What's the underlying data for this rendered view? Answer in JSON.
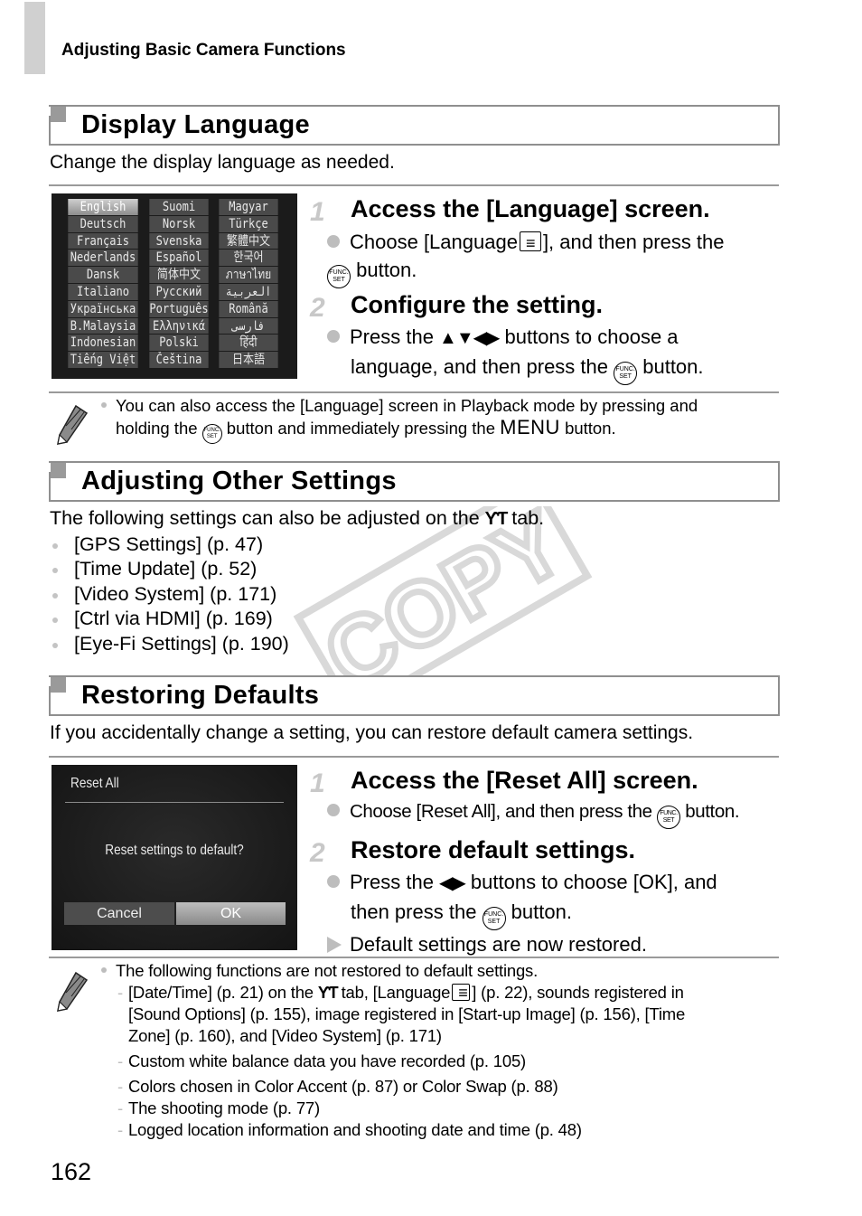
{
  "running_head": "Adjusting Basic Camera Functions",
  "page_number": "162",
  "watermark": "COPY",
  "sections": {
    "display_language": {
      "title": "Display Language",
      "intro": "Change the display language as needed.",
      "screen": {
        "languages": [
          "English",
          "Suomi",
          "Magyar",
          "Deutsch",
          "Norsk",
          "Türkçe",
          "Français",
          "Svenska",
          "繁體中文",
          "Nederlands",
          "Español",
          "한국어",
          "Dansk",
          "简体中文",
          "ภาษาไทย",
          "Italiano",
          "Русский",
          "العربية",
          "Українська",
          "Português",
          "Română",
          "B.Malaysia",
          "Ελληνικά",
          "فارسی",
          "Indonesian",
          "Polski",
          "हिंदी",
          "Tiếng Việt",
          "Čeština",
          "日本語"
        ],
        "selected": "English"
      },
      "steps": [
        {
          "number": "1",
          "title": "Access the [Language] screen.",
          "bullet_part1": "Choose [Language",
          "bullet_part2": "], and then press the",
          "bullet_line2": " button."
        },
        {
          "number": "2",
          "title": "Configure the setting.",
          "bullet_part1": "Press the ",
          "arrows": "▲▼◀▶",
          "bullet_part2": " buttons to choose a",
          "bullet_line2a": "language, and then press the ",
          "bullet_line2b": " button."
        }
      ],
      "note": {
        "line1": "You can also access the [Language] screen in Playback mode by pressing and",
        "line2a": "holding the ",
        "line2b": " button and immediately pressing the ",
        "menu": "MENU",
        "line2c": " button."
      }
    },
    "other_settings": {
      "title": "Adjusting Other Settings",
      "intro_a": "The following settings can also be adjusted on the ",
      "tab_icon": "ƳƬ",
      "intro_b": " tab.",
      "items": [
        "[GPS Settings] (p. 47)",
        "[Time Update] (p. 52)",
        "[Video System] (p. 171)",
        "[Ctrl via HDMI] (p. 169)",
        "[Eye-Fi Settings] (p. 190)"
      ]
    },
    "restoring_defaults": {
      "title": "Restoring Defaults",
      "intro": "If you accidentally change a setting, you can restore default camera settings.",
      "screen": {
        "title": "Reset All",
        "question": "Reset settings to default?",
        "cancel": "Cancel",
        "ok": "OK"
      },
      "steps": [
        {
          "number": "1",
          "title": "Access the [Reset All] screen.",
          "bullet_a": "Choose [Reset All], and then press the ",
          "bullet_b": " button."
        },
        {
          "number": "2",
          "title": "Restore default settings.",
          "bullet_a": "Press the ",
          "arrows": "◀▶",
          "bullet_b": " buttons to choose [OK], and",
          "bullet_line2a": "then press the ",
          "bullet_line2b": " button.",
          "result": "Default settings are now restored."
        }
      ],
      "note": {
        "heading": "The following functions are not restored to default settings.",
        "item1_a": "[Date/Time] (p. 21) on the ",
        "item1_b": " tab, [Language",
        "item1_c": "] (p. 22), sounds registered in",
        "item1_line2": "[Sound Options] (p. 155), image registered in [Start-up Image] (p. 156), [Time",
        "item1_line3": "Zone] (p. 160), and [Video System] (p. 171)",
        "items": [
          "Custom white balance data you have recorded (p. 105)",
          "Colors chosen in Color Accent (p. 87) or Color Swap (p. 88)",
          "The shooting mode (p. 77)",
          "Logged location information and shooting date and time (p. 48)"
        ]
      }
    }
  },
  "icons": {
    "func_set": "FUNC.\nSET",
    "func_top": "FUNC.",
    "func_bottom": "SET"
  }
}
